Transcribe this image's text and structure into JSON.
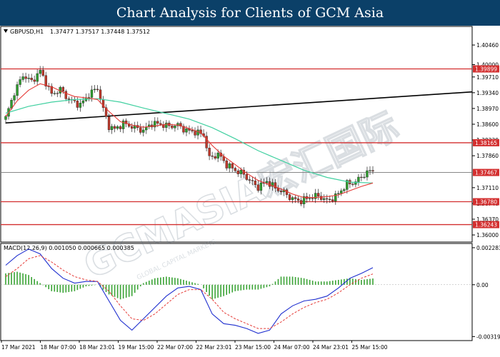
{
  "banner": {
    "title": "Chart Analysis for Clients of GCM Asia"
  },
  "watermark": {
    "text": "GCMASIA宏汇国际",
    "subtext": "GLOBAL CAPITAL MARKETS"
  },
  "colors": {
    "banner_bg": "#0b4068",
    "bull_candle": "#2e9e2e",
    "bear_candle": "#c0392b",
    "ma_fast": "#e53935",
    "ma_slow": "#40d0a0",
    "trendline": "#000000",
    "level_line": "#d32f2f",
    "level_tag_bg": "#d32f2f",
    "price_tag_bg": "#d32f2f",
    "macd_line": "#1f2fcf",
    "macd_signal": "#e53935",
    "macd_hist": "#3aa335"
  },
  "chart_data": [
    {
      "type": "candlestick",
      "title": "GBPUSD,H1",
      "ohlc_header": "1.37477 1.37517 1.37448 1.37512",
      "ylim": [
        1.3585,
        1.4088
      ],
      "y_ticks": [
        "1.40460",
        "1.40000",
        "1.39710",
        "1.39340",
        "1.38970",
        "1.38600",
        "1.38230",
        "1.37860",
        "1.37110",
        "1.36740",
        "1.36370",
        "1.36000"
      ],
      "x_tick_labels": [
        "17 Mar 2021",
        "18 Mar 07:00",
        "18 Mar 23:01",
        "19 Mar 15:00",
        "22 Mar 07:00",
        "22 Mar 23:01",
        "23 Mar 15:00",
        "24 Mar 07:00",
        "24 Mar 23:01",
        "25 Mar 15:00"
      ],
      "current_price": 1.37467,
      "current_price_label": "1.37467",
      "horizontal_levels": [
        {
          "value": 1.39899,
          "label": "1.39899"
        },
        {
          "value": 1.38165,
          "label": "1.38165"
        },
        {
          "value": 1.3678,
          "label": "1.36780"
        },
        {
          "value": 1.36243,
          "label": "1.36243"
        }
      ],
      "trendline": {
        "start": {
          "index": 0,
          "value": 1.3863
        },
        "end": {
          "index": 128,
          "value": 1.3936
        }
      },
      "close_path": [
        [
          0,
          1.3875
        ],
        [
          3,
          1.3935
        ],
        [
          6,
          1.3975
        ],
        [
          9,
          1.396
        ],
        [
          12,
          1.3985
        ],
        [
          14,
          1.3958
        ],
        [
          16,
          1.393
        ],
        [
          19,
          1.3942
        ],
        [
          22,
          1.3918
        ],
        [
          26,
          1.3905
        ],
        [
          29,
          1.393
        ],
        [
          32,
          1.3945
        ],
        [
          34,
          1.3895
        ],
        [
          36,
          1.3855
        ],
        [
          38,
          1.3848
        ],
        [
          41,
          1.3862
        ],
        [
          45,
          1.3852
        ],
        [
          48,
          1.3845
        ],
        [
          51,
          1.3862
        ],
        [
          54,
          1.386
        ],
        [
          57,
          1.3855
        ],
        [
          60,
          1.3858
        ],
        [
          63,
          1.3845
        ],
        [
          66,
          1.3842
        ],
        [
          69,
          1.3835
        ],
        [
          71,
          1.378
        ],
        [
          74,
          1.379
        ],
        [
          77,
          1.3765
        ],
        [
          80,
          1.3752
        ],
        [
          83,
          1.3742
        ],
        [
          85,
          1.3728
        ],
        [
          88,
          1.3712
        ],
        [
          91,
          1.3726
        ],
        [
          94,
          1.371
        ],
        [
          97,
          1.37
        ],
        [
          100,
          1.3684
        ],
        [
          103,
          1.368
        ],
        [
          106,
          1.3688
        ],
        [
          109,
          1.3692
        ],
        [
          112,
          1.368
        ],
        [
          115,
          1.369
        ],
        [
          117,
          1.3705
        ],
        [
          119,
          1.372
        ],
        [
          121,
          1.3722
        ],
        [
          123,
          1.373
        ],
        [
          125,
          1.3742
        ],
        [
          127,
          1.375
        ],
        [
          128,
          1.3751
        ]
      ],
      "ma_fast_path": [
        [
          0,
          1.3878
        ],
        [
          4,
          1.3915
        ],
        [
          8,
          1.394
        ],
        [
          12,
          1.3955
        ],
        [
          16,
          1.3948
        ],
        [
          20,
          1.3935
        ],
        [
          24,
          1.3925
        ],
        [
          28,
          1.3922
        ],
        [
          32,
          1.3918
        ],
        [
          36,
          1.389
        ],
        [
          40,
          1.3866
        ],
        [
          44,
          1.3858
        ],
        [
          48,
          1.3853
        ],
        [
          52,
          1.3856
        ],
        [
          56,
          1.386
        ],
        [
          60,
          1.3858
        ],
        [
          64,
          1.385
        ],
        [
          68,
          1.384
        ],
        [
          72,
          1.381
        ],
        [
          76,
          1.3785
        ],
        [
          80,
          1.3765
        ],
        [
          84,
          1.3745
        ],
        [
          88,
          1.3728
        ],
        [
          92,
          1.3718
        ],
        [
          96,
          1.3708
        ],
        [
          100,
          1.3696
        ],
        [
          104,
          1.3688
        ],
        [
          108,
          1.3688
        ],
        [
          112,
          1.369
        ],
        [
          116,
          1.3694
        ],
        [
          120,
          1.3704
        ],
        [
          124,
          1.3714
        ],
        [
          128,
          1.3722
        ]
      ],
      "ma_slow_path": [
        [
          0,
          1.3886
        ],
        [
          8,
          1.3902
        ],
        [
          16,
          1.3912
        ],
        [
          24,
          1.3918
        ],
        [
          32,
          1.392
        ],
        [
          40,
          1.3912
        ],
        [
          48,
          1.3898
        ],
        [
          56,
          1.3885
        ],
        [
          64,
          1.3872
        ],
        [
          72,
          1.3852
        ],
        [
          80,
          1.3826
        ],
        [
          88,
          1.3798
        ],
        [
          96,
          1.3775
        ],
        [
          104,
          1.3752
        ],
        [
          112,
          1.3735
        ],
        [
          120,
          1.3724
        ],
        [
          128,
          1.3722
        ]
      ]
    },
    {
      "type": "macd",
      "title": "MACD(12,26,9) 0.001050 0.000665 0.000385",
      "ylim": [
        -0.0034,
        0.0025
      ],
      "y_ticks": [
        "0.002283",
        "0.00",
        "-0.003195"
      ],
      "macd_path": [
        [
          0,
          0.0012
        ],
        [
          4,
          0.0018
        ],
        [
          8,
          0.0022
        ],
        [
          12,
          0.0019
        ],
        [
          16,
          0.001
        ],
        [
          20,
          0.0004
        ],
        [
          24,
          0.0001
        ],
        [
          28,
          0.0002
        ],
        [
          32,
          0.0002
        ],
        [
          36,
          -0.001
        ],
        [
          40,
          -0.0022
        ],
        [
          44,
          -0.0028
        ],
        [
          48,
          -0.0021
        ],
        [
          52,
          -0.0014
        ],
        [
          56,
          -0.0007
        ],
        [
          60,
          -0.0002
        ],
        [
          64,
          -0.0001
        ],
        [
          68,
          -0.0003
        ],
        [
          72,
          -0.0018
        ],
        [
          76,
          -0.0024
        ],
        [
          80,
          -0.0025
        ],
        [
          84,
          -0.0027
        ],
        [
          88,
          -0.003
        ],
        [
          92,
          -0.0028
        ],
        [
          96,
          -0.0018
        ],
        [
          100,
          -0.0013
        ],
        [
          104,
          -0.001
        ],
        [
          108,
          -0.0009
        ],
        [
          112,
          -0.0007
        ],
        [
          116,
          -0.0002
        ],
        [
          120,
          0.0004
        ],
        [
          124,
          0.0007
        ],
        [
          128,
          0.00105
        ]
      ],
      "signal_path": [
        [
          0,
          0.0005
        ],
        [
          4,
          0.001
        ],
        [
          8,
          0.0016
        ],
        [
          12,
          0.0018
        ],
        [
          16,
          0.0014
        ],
        [
          20,
          0.0009
        ],
        [
          24,
          0.0005
        ],
        [
          28,
          0.0003
        ],
        [
          32,
          0.0002
        ],
        [
          36,
          -0.0004
        ],
        [
          40,
          -0.0013
        ],
        [
          44,
          -0.0021
        ],
        [
          48,
          -0.0022
        ],
        [
          52,
          -0.0018
        ],
        [
          56,
          -0.0012
        ],
        [
          60,
          -0.0006
        ],
        [
          64,
          -0.0003
        ],
        [
          68,
          -0.0003
        ],
        [
          72,
          -0.0009
        ],
        [
          76,
          -0.0017
        ],
        [
          80,
          -0.0021
        ],
        [
          84,
          -0.0024
        ],
        [
          88,
          -0.0027
        ],
        [
          92,
          -0.0027
        ],
        [
          96,
          -0.0023
        ],
        [
          100,
          -0.0018
        ],
        [
          104,
          -0.0014
        ],
        [
          108,
          -0.0011
        ],
        [
          112,
          -0.0009
        ],
        [
          116,
          -0.0005
        ],
        [
          120,
          0.0
        ],
        [
          124,
          0.0004
        ],
        [
          128,
          0.000665
        ]
      ]
    }
  ]
}
